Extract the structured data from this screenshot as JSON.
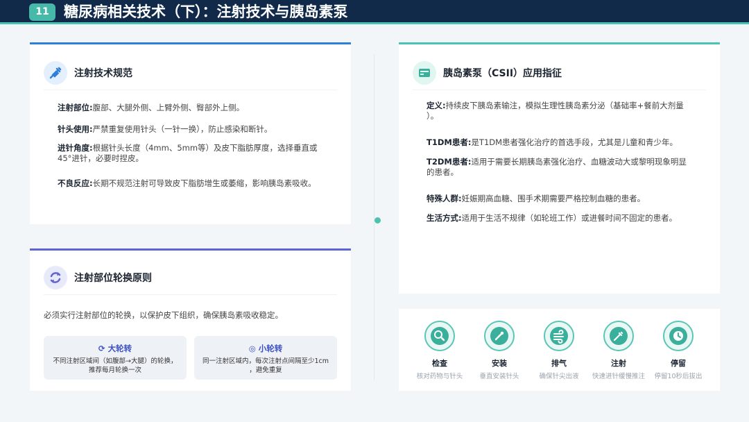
{
  "header": {
    "number": "11",
    "title": "糖尿病相关技术（下）：注射技术与胰岛素泵"
  },
  "injection_spec": {
    "title": "注射技术规范",
    "items": [
      {
        "label": "注射部位:",
        "text": "腹部、大腿外侧、上臂外侧、臀部外上侧。"
      },
      {
        "label": "针头使用:",
        "text": "严禁重复使用针头（一针一换），防止感染和断针。"
      },
      {
        "label": "进针角度:",
        "text": "根据针头长度（4mm、5mm等）及皮下脂肪厚度，选择垂直或",
        "text2": "45°进针，必要时捏皮。"
      },
      {
        "label": "不良反应:",
        "text": "长期不规范注射可导致皮下脂肪增生或萎缩，影响胰岛素吸收。"
      }
    ]
  },
  "rotation": {
    "title": "注射部位轮换原则",
    "intro": "必须实行注射部位的轮换，以保护皮下组织，确保胰岛素吸收稳定。",
    "big": {
      "title": "大轮转",
      "desc1": "不同注射区域间（如腹部→大腿）的轮换，",
      "desc2": "推荐每月轮换一次"
    },
    "small": {
      "title": "小轮转",
      "desc1": "同一注射区域内，每次注射点间隔至少1cm",
      "desc2": "，避免重复"
    }
  },
  "pump": {
    "title": "胰岛素泵（CSII）应用指征",
    "items": [
      {
        "label": "定义:",
        "text": "持续皮下胰岛素输注，模拟生理性胰岛素分泌（基础率+餐前大剂量",
        "text2": "）。"
      },
      {
        "label": "T1DM患者:",
        "text": "是T1DM患者强化治疗的首选手段，尤其是儿童和青少年。"
      },
      {
        "label": "T2DM患者:",
        "text": "适用于需要长期胰岛素强化治疗、血糖波动大或黎明现象明显",
        "text2": "的患者。"
      },
      {
        "label": "特殊人群:",
        "text": "妊娠期高血糖、围手术期需要严格控制血糖的患者。"
      },
      {
        "label": "生活方式:",
        "text": "适用于生活不规律（如轮班工作）或进餐时间不固定的患者。"
      }
    ]
  },
  "steps": [
    {
      "label": "检查",
      "desc": "核对药物与针头",
      "icon": "magnifier-icon"
    },
    {
      "label": "安装",
      "desc": "垂直安装针头",
      "icon": "brush-icon"
    },
    {
      "label": "排气",
      "desc": "确保针尖出液",
      "icon": "wind-icon"
    },
    {
      "label": "注射",
      "desc": "快速进针缓慢推注",
      "icon": "syringe-icon"
    },
    {
      "label": "停留",
      "desc": "停留10秒后拔出",
      "icon": "clock-icon"
    }
  ]
}
